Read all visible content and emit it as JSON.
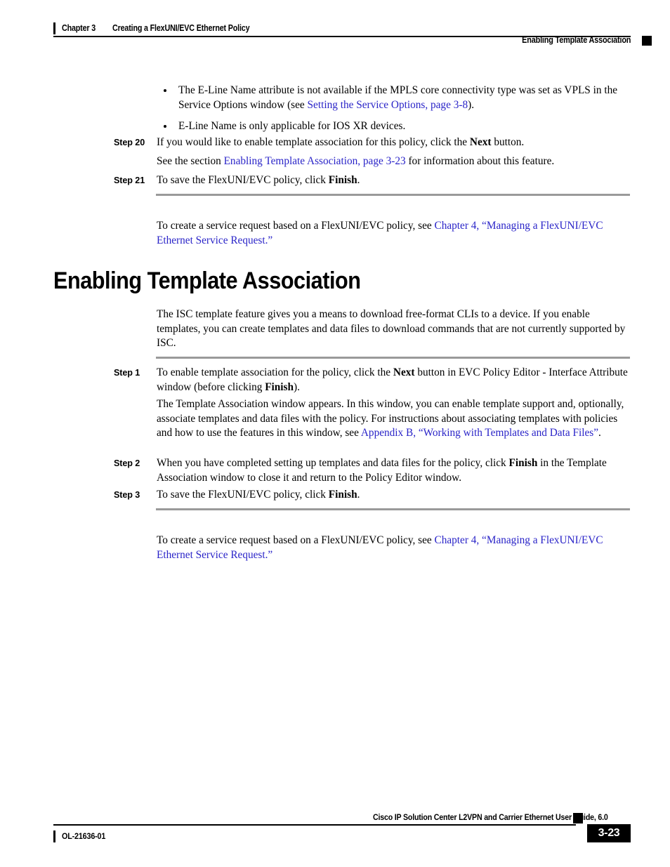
{
  "header": {
    "chapter_label": "Chapter 3",
    "chapter_title": "Creating a FlexUNI/EVC Ethernet Policy",
    "running_head": "Enabling Template Association"
  },
  "bullets": [
    {
      "text_before": "The E-Line Name attribute is not available if the MPLS core connectivity type was set as VPLS in the Service Options window (see ",
      "link": "Setting the Service Options, page 3-8",
      "text_after": ")."
    },
    {
      "text_before": "E-Line Name is only applicable for IOS XR devices.",
      "link": "",
      "text_after": ""
    }
  ],
  "steps_top": [
    {
      "label": "Step 20",
      "line1_a": "If you would like to enable template association for this policy, click the ",
      "line1_bold": "Next",
      "line1_b": " button.",
      "line2_a": "See the section ",
      "line2_link": "Enabling Template Association, page 3-23",
      "line2_b": " for information about this feature."
    },
    {
      "label": "Step 21",
      "line1_a": "To save the FlexUNI/EVC policy, click ",
      "line1_bold": "Finish",
      "line1_b": "."
    }
  ],
  "closing_top": {
    "text_before": "To create a service request based on a FlexUNI/EVC policy, see ",
    "link": "Chapter 4, “Managing a FlexUNI/EVC Ethernet Service Request.”",
    "text_after": ""
  },
  "section": {
    "title": "Enabling Template Association",
    "intro": "The ISC template feature gives you a means to download free-format CLIs to a device. If you enable templates, you can create templates and data files to download commands that are not currently supported by ISC."
  },
  "steps_bottom": [
    {
      "label": "Step 1",
      "p1_a": "To enable template association for the policy, click the ",
      "p1_bold1": "Next",
      "p1_b": " button in EVC Policy Editor - Interface Attribute window (before clicking ",
      "p1_bold2": "Finish",
      "p1_c": ").",
      "p2_a": "The Template Association window appears. In this window, you can enable template support and, optionally, associate templates and data files with the policy. For instructions about associating templates with policies and how to use the features in this window, see ",
      "p2_link": "Appendix B, “Working with Templates and Data Files”",
      "p2_b": "."
    },
    {
      "label": "Step 2",
      "p1_a": "When you have completed setting up templates and data files for the policy, click ",
      "p1_bold1": "Finish",
      "p1_b": " in the Template Association window to close it and return to the Policy Editor window."
    },
    {
      "label": "Step 3",
      "p1_a": "To save the FlexUNI/EVC policy, click ",
      "p1_bold1": "Finish",
      "p1_b": "."
    }
  ],
  "closing_bottom": {
    "text_before": "To create a service request based on a FlexUNI/EVC policy, see ",
    "link": "Chapter 4, “Managing a FlexUNI/EVC Ethernet Service Request.”"
  },
  "footer": {
    "guide_title": "Cisco IP Solution Center L2VPN and Carrier Ethernet User Guide, 6.0",
    "doc_id": "OL-21636-01",
    "page_number": "3-23"
  },
  "colors": {
    "link": "#2a24c8",
    "rule_gray": "#9a9a9a",
    "ink": "#000000"
  }
}
